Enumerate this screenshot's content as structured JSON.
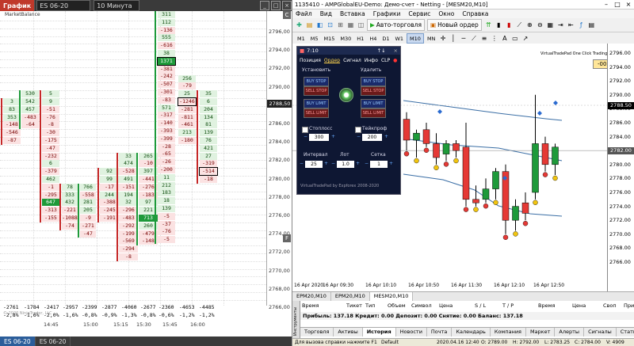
{
  "left": {
    "tab_label": "График",
    "symbol": "ES 06-20",
    "timeframe": "10 Минута",
    "indicator_name": "MarketBalance",
    "price_axis": [
      "2796,00",
      "2794,00",
      "2792,00",
      "2790,00",
      "2788,00",
      "2786,00",
      "2784,00",
      "2782,00",
      "2780,00",
      "2778,00",
      "2776,00",
      "2774,00",
      "2772,00",
      "2770,00",
      "2768,00",
      "2766,00"
    ],
    "current_price": "2788,50",
    "totals": [
      "-2761",
      "-1784",
      "-2417",
      "-2957",
      "-2399",
      "-2877",
      "-4060",
      "-2677",
      "-2360",
      "-4653",
      "-4485"
    ],
    "total_pcts": [
      "-2,8%",
      "-1,6%",
      "-2,0%",
      "-1,6%",
      "-0,8%",
      "-0,9%",
      "-1,3%",
      "-0,8%",
      "-0,6%",
      "-1,2%",
      "-1,2%"
    ],
    "times": [
      "14:45",
      "15:00",
      "15:15",
      "15:30",
      "15:45",
      "16:00"
    ],
    "watermark": "© 2020 NinjaTrader, LLC",
    "bottom_tabs": [
      "ES 06-20",
      "ES 06-20"
    ],
    "columns": [
      {
        "cells": [
          {
            "v": "3",
            "t": "pos"
          },
          {
            "v": "83",
            "t": "pos"
          },
          {
            "v": "353",
            "t": "pos"
          },
          {
            "v": "-148",
            "t": "neg"
          },
          {
            "v": "-546",
            "t": "neg"
          },
          {
            "v": "-87",
            "t": "neg"
          }
        ]
      },
      {
        "cells": [
          {
            "v": "530",
            "t": "pos"
          },
          {
            "v": "542",
            "t": "pos"
          },
          {
            "v": "457",
            "t": "pos"
          },
          {
            "v": "-483",
            "t": "neg"
          },
          {
            "v": "-64",
            "t": "neg"
          }
        ]
      },
      {
        "cells": [
          {
            "v": "5",
            "t": "pos"
          },
          {
            "v": "9",
            "t": "pos"
          },
          {
            "v": "-51",
            "t": "neg"
          },
          {
            "v": "-76",
            "t": "neg"
          },
          {
            "v": "-8",
            "t": "neg"
          },
          {
            "v": "-30",
            "t": "neg"
          },
          {
            "v": "-175",
            "t": "neg"
          },
          {
            "v": "-47",
            "t": "neg"
          },
          {
            "v": "-232",
            "t": "neg"
          },
          {
            "v": "6",
            "t": "pos"
          },
          {
            "v": "-379",
            "t": "neg"
          },
          {
            "v": "462",
            "t": "pos"
          },
          {
            "v": "-1",
            "t": "neg"
          },
          {
            "v": "-295",
            "t": "neg"
          },
          {
            "v": "647",
            "t": "hot"
          },
          {
            "v": "-313",
            "t": "neg"
          },
          {
            "v": "-155",
            "t": "neg"
          }
        ]
      },
      {
        "cells": [
          {
            "v": "78",
            "t": "pos"
          },
          {
            "v": "333",
            "t": "pos"
          },
          {
            "v": "432",
            "t": "pos"
          },
          {
            "v": "-221",
            "t": "neg"
          },
          {
            "v": "-1088",
            "t": "neg"
          },
          {
            "v": "-74",
            "t": "neg"
          }
        ]
      },
      {
        "cells": [
          {
            "v": "766",
            "t": "pos"
          },
          {
            "v": "-558",
            "t": "neg"
          },
          {
            "v": "281",
            "t": "pos"
          },
          {
            "v": "205",
            "t": "pos"
          },
          {
            "v": "-9",
            "t": "neg"
          },
          {
            "v": "-271",
            "t": "neg"
          },
          {
            "v": "-47",
            "t": "neg"
          }
        ]
      },
      {
        "cells": [
          {
            "v": "92",
            "t": "pos"
          },
          {
            "v": "99",
            "t": "pos"
          },
          {
            "v": "-17",
            "t": "neg"
          },
          {
            "v": "244",
            "t": "pos"
          },
          {
            "v": "-388",
            "t": "neg"
          },
          {
            "v": "-245",
            "t": "neg"
          },
          {
            "v": "-191",
            "t": "neg"
          }
        ]
      },
      {
        "cells": [
          {
            "v": "33",
            "t": "pos"
          },
          {
            "v": "474",
            "t": "pos"
          },
          {
            "v": "-528",
            "t": "neg"
          },
          {
            "v": "491",
            "t": "pos"
          },
          {
            "v": "-151",
            "t": "neg"
          },
          {
            "v": "194",
            "t": "pos"
          },
          {
            "v": "32",
            "t": "pos"
          },
          {
            "v": "-296",
            "t": "neg"
          },
          {
            "v": "-483",
            "t": "neg"
          },
          {
            "v": "-292",
            "t": "neg"
          },
          {
            "v": "-199",
            "t": "neg"
          },
          {
            "v": "-569",
            "t": "neg"
          },
          {
            "v": "-294",
            "t": "neg"
          },
          {
            "v": "-8",
            "t": "neg"
          }
        ]
      },
      {
        "cells": [
          {
            "v": "265",
            "t": "pos"
          },
          {
            "v": "-10",
            "t": "neg"
          },
          {
            "v": "397",
            "t": "pos"
          },
          {
            "v": "-441",
            "t": "neg"
          },
          {
            "v": "-276",
            "t": "neg"
          },
          {
            "v": "-183",
            "t": "neg"
          },
          {
            "v": "97",
            "t": "pos"
          },
          {
            "v": "221",
            "t": "pos"
          },
          {
            "v": "713",
            "t": "hot"
          },
          {
            "v": "260",
            "t": "pos"
          },
          {
            "v": "-479",
            "t": "neg"
          },
          {
            "v": "-148",
            "t": "neg"
          }
        ]
      }
    ],
    "big_column": [
      "311",
      "112",
      "-136",
      "555",
      "-616",
      "38",
      "1371",
      "-381",
      "-242",
      "-507",
      "-301",
      "-83",
      "571",
      "-317",
      "-140",
      "-393",
      "-399",
      "-28",
      "-65",
      "-26",
      "-200",
      "11",
      "212",
      "183",
      "18",
      "139",
      "-5",
      "-37",
      "-76",
      "-5"
    ],
    "col9": [
      "256",
      "-79",
      "25",
      "-1246",
      "-281",
      "-811",
      "-461",
      "213",
      "-180"
    ],
    "col10": [
      "35",
      "6",
      "204",
      "134",
      "81",
      "139",
      "76",
      "421",
      "27",
      "-319",
      "-514",
      "-18"
    ]
  },
  "right": {
    "title": "1135410 - AMPGlobalEU-Demo: Демо-счет - Netting - [MESM20,M10]",
    "menu": [
      "Файл",
      "Вид",
      "Вставка",
      "Графики",
      "Сервис",
      "Окно",
      "Справка"
    ],
    "algo_button": "Авто-торговля",
    "new_order_button": "Новый ордер",
    "timeframes": [
      "M1",
      "M5",
      "M15",
      "M30",
      "H1",
      "H4",
      "D1",
      "W1",
      "MN"
    ],
    "active_timeframe": "M10",
    "overlay_title": "VirtualTradePad One Click Trading Panel",
    "countdown": "-00:02:50",
    "price_axis": [
      "2796.00",
      "2794.00",
      "2792.00",
      "2790.00",
      "2788.00",
      "2786.00",
      "2784.00",
      "2782.00",
      "2780.00",
      "2778.00",
      "2776.00",
      "2774.00",
      "2772.00",
      "2770.00",
      "2768.00",
      "2766.00"
    ],
    "current_price": "2788.50",
    "secondary_price": "2782.00",
    "x_labels": [
      "16 Apr 2020",
      "16 Apr 09:30",
      "16 Apr 10:10",
      "16 Apr 10:50",
      "16 Apr 11:30",
      "16 Apr 12:10",
      "16 Apr 12:50"
    ],
    "chart_tabs": [
      "EPM20,M10",
      "EPM20,M10",
      "MESM20,M10"
    ],
    "vtp": {
      "time": "7:10",
      "tabs": [
        "Позиция",
        "Ордер",
        "Сигнал",
        "Инфо",
        "CLP"
      ],
      "set_label": "Установить",
      "del_label": "Удалить",
      "btns": [
        "BUY STOP",
        "SELL STOP",
        "BUY LIMIT",
        "SELL LIMIT"
      ],
      "stoploss_label": "Стоплосс",
      "takeprofit_label": "Тейкпроф",
      "stoploss_value": "300",
      "takeprofit_value": "200",
      "interval_label": "Интервал",
      "lot_label": "Лот",
      "grid_label": "Сетка",
      "interval_value": "25",
      "lot_value": "1.0",
      "grid_value": "1",
      "footer": "VirtualTradePad by Expforex 2008-2020"
    },
    "terminal": {
      "side_label": "Инструменты",
      "headers": [
        "Время",
        "Тикет",
        "Тип",
        "Объем",
        "Символ",
        "Цена",
        "S / L",
        "T / P",
        "Время",
        "Цена",
        "Своп",
        "Приб"
      ],
      "balance_row": "Прибыль: 137.18  Кредит: 0.00  Депозит: 0.00  Снятие: 0.00  Баланс: 137.18",
      "tabs": [
        "Торговля",
        "Активы",
        "История",
        "Новости",
        "Почта",
        "Календарь",
        "Компания",
        "Маркет",
        "Алерты",
        "Сигналы",
        "Статьи",
        "Библ"
      ],
      "active_tab": "История"
    },
    "status": {
      "help": "Для вызова справки нажмите F1",
      "profile": "Default",
      "time": "2020.04.16 12:40",
      "open": "O: 2789.00",
      "high": "H: 2792.00",
      "low": "L: 2783.25",
      "close": "C: 2784.00",
      "vol": "V: 4909"
    },
    "chart_data": {
      "type": "candlestick",
      "candles": [
        {
          "o": 2786.5,
          "h": 2787.5,
          "l": 2782.0,
          "c": 2783.5,
          "d": "down"
        },
        {
          "o": 2783.5,
          "h": 2785.0,
          "l": 2781.0,
          "c": 2784.5,
          "d": "up"
        },
        {
          "o": 2785.0,
          "h": 2786.0,
          "l": 2782.5,
          "c": 2783.0,
          "d": "down"
        },
        {
          "o": 2783.0,
          "h": 2784.5,
          "l": 2780.0,
          "c": 2781.0,
          "d": "down"
        },
        {
          "o": 2781.5,
          "h": 2783.5,
          "l": 2780.5,
          "c": 2783.0,
          "d": "up"
        },
        {
          "o": 2783.0,
          "h": 2783.5,
          "l": 2781.0,
          "c": 2782.0,
          "d": "down"
        },
        {
          "o": 2782.5,
          "h": 2786.0,
          "l": 2774.0,
          "c": 2775.0,
          "d": "down"
        },
        {
          "o": 2775.0,
          "h": 2777.0,
          "l": 2774.0,
          "c": 2774.5,
          "d": "down"
        },
        {
          "o": 2775.0,
          "h": 2778.0,
          "l": 2774.5,
          "c": 2776.5,
          "d": "up"
        },
        {
          "o": 2776.5,
          "h": 2779.5,
          "l": 2775.0,
          "c": 2779.0,
          "d": "up"
        },
        {
          "o": 2779.0,
          "h": 2780.0,
          "l": 2770.0,
          "c": 2772.0,
          "d": "down"
        },
        {
          "o": 2772.0,
          "h": 2775.0,
          "l": 2770.5,
          "c": 2774.0,
          "d": "up"
        },
        {
          "o": 2774.5,
          "h": 2776.0,
          "l": 2772.0,
          "c": 2773.0,
          "d": "down"
        },
        {
          "o": 2776.0,
          "h": 2790.0,
          "l": 2775.0,
          "c": 2783.0,
          "d": "up"
        },
        {
          "o": 2783.0,
          "h": 2784.0,
          "l": 2779.0,
          "c": 2780.0,
          "d": "down"
        },
        {
          "o": 2780.0,
          "h": 2783.0,
          "l": 2778.5,
          "c": 2782.5,
          "d": "up"
        }
      ],
      "x_labels": [
        "16 Apr 2020",
        "16 Apr 09:30",
        "16 Apr 10:10",
        "16 Apr 10:50",
        "16 Apr 11:30",
        "16 Apr 12:10",
        "16 Apr 12:50"
      ],
      "y_axis": [
        "2796.00",
        "2794.00",
        "2792.00",
        "2790.00",
        "2788.00",
        "2786.00",
        "2784.00",
        "2782.00",
        "2780.00",
        "2778.00",
        "2776.00",
        "2774.00",
        "2772.00",
        "2770.00",
        "2768.00",
        "2766.00"
      ]
    }
  }
}
